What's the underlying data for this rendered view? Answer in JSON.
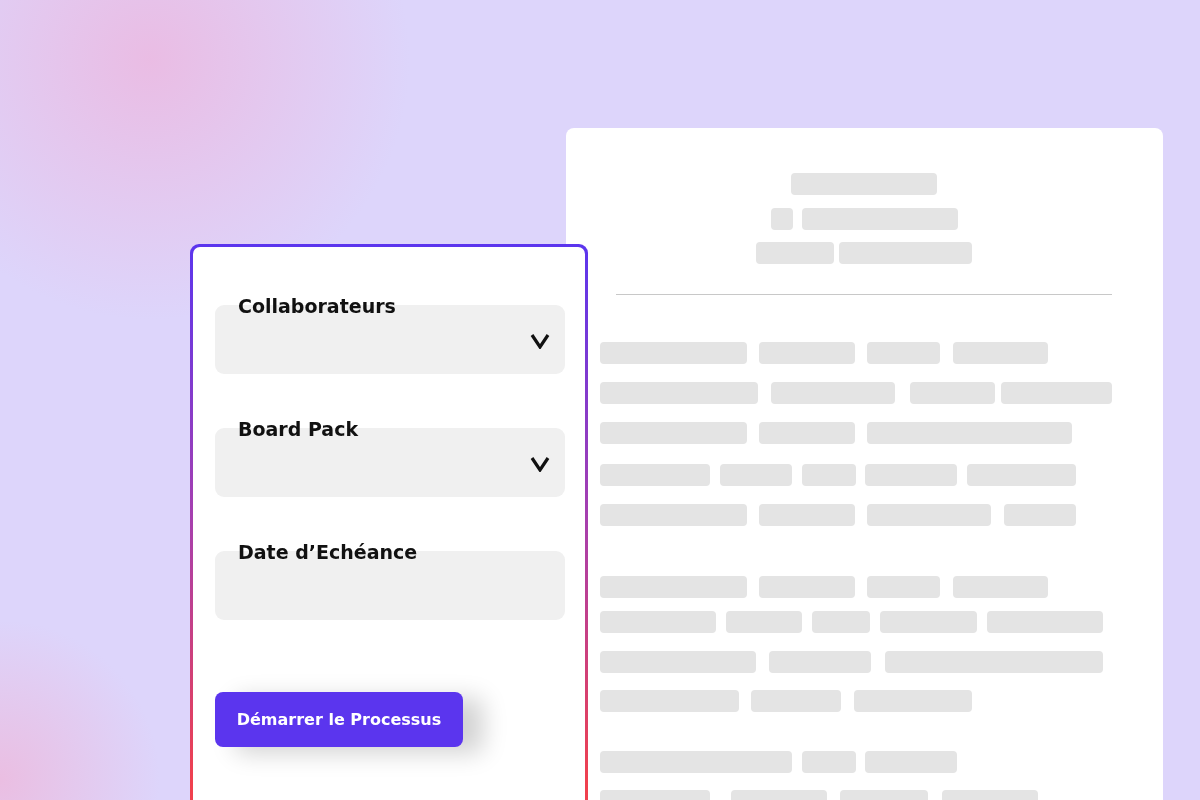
{
  "form": {
    "fields": [
      {
        "label": "Collaborateurs",
        "kind": "select"
      },
      {
        "label": "Board Pack",
        "kind": "select"
      },
      {
        "label": "Date d’Echéance",
        "kind": "date"
      }
    ],
    "submit_button": "Démarrer le Processus"
  }
}
